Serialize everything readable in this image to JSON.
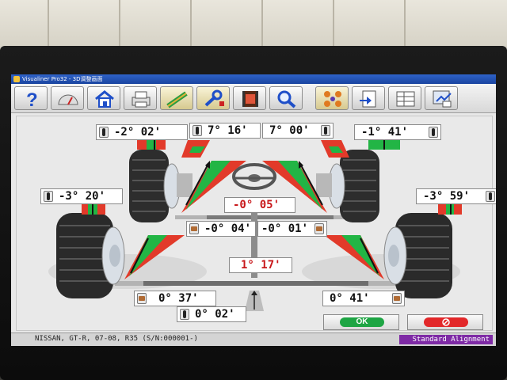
{
  "window": {
    "title": "Visualiner Pro32 - 3D调整画面"
  },
  "toolbar": {
    "buttons": [
      {
        "name": "help",
        "icon": "help-icon"
      },
      {
        "name": "gauge",
        "icon": "gauge-icon"
      },
      {
        "name": "home",
        "icon": "home-icon"
      },
      {
        "name": "print",
        "icon": "printer-icon"
      },
      {
        "name": "measure",
        "icon": "measure-icon"
      },
      {
        "name": "adjust",
        "icon": "wrench-icon"
      },
      {
        "name": "video",
        "icon": "film-icon"
      },
      {
        "name": "zoom",
        "icon": "magnifier-icon"
      },
      {
        "name": "wheels",
        "icon": "wheels-icon"
      },
      {
        "name": "report",
        "icon": "report-icon"
      },
      {
        "name": "specs",
        "icon": "specs-icon"
      },
      {
        "name": "customer",
        "icon": "customer-icon"
      }
    ]
  },
  "readings": {
    "front_left_camber": "-2° 02'",
    "front_left_toe": "7° 16'",
    "front_right_toe": "7° 00'",
    "front_right_camber": "-1° 41'",
    "rear_left_camber": "-3° 20'",
    "rear_right_camber": "-3° 59'",
    "steering": "-0° 05'",
    "front_left_ind_toe": "-0° 04'",
    "front_right_ind_toe": "-0° 01'",
    "total_toe": "1° 17'",
    "rear_left_toe": "0° 37'",
    "rear_right_toe": "0° 41'",
    "thrust_angle": "0° 02'"
  },
  "colors": {
    "in_spec": "#22b545",
    "out_of_spec": "#e23a2a",
    "accent": "#c8181b"
  },
  "buttons": {
    "ok_label": "OK",
    "cancel_icon": "cancel-icon"
  },
  "status": {
    "vehicle": "NISSAN, GT-R, 07-08, R35 (S/N:000001-)",
    "mode": "Standard Alignment"
  }
}
